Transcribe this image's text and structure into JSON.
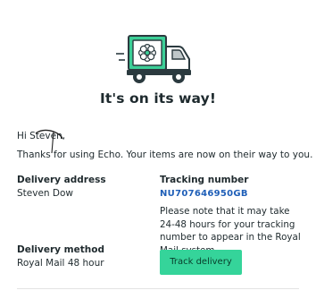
{
  "header": {
    "headline": "It's on its way!"
  },
  "email": {
    "greeting": "Hi Steven,",
    "thanks": "Thanks for using Echo. Your items are now on their way to you."
  },
  "delivery": {
    "address_label": "Delivery address",
    "address_name": "Steven Dow",
    "method_label": "Delivery method",
    "method_value": "Royal Mail 48 hour"
  },
  "tracking": {
    "label": "Tracking number",
    "number": "NU707646950GB",
    "note": "Please note that it may take 24-48 hours for your tracking number to appear in the Royal Mail system",
    "button_label": "Track delivery"
  },
  "colors": {
    "accent_green": "#35d49a",
    "link_blue": "#1f5fb8",
    "truck_dark": "#2b3a3f"
  },
  "icons": {
    "hero": "delivery-truck-icon"
  }
}
